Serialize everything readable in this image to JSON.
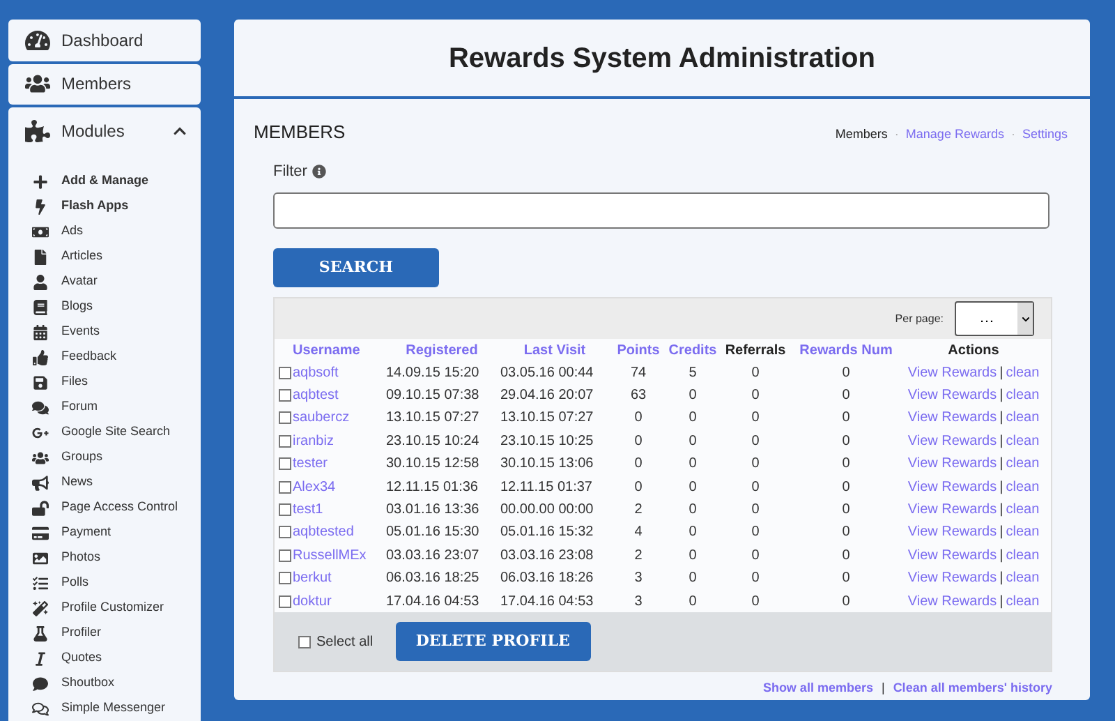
{
  "sidebar": {
    "items": [
      {
        "label": "Dashboard"
      },
      {
        "label": "Members"
      }
    ],
    "modules": {
      "label": "Modules",
      "expanded": true,
      "items": [
        {
          "label": "Add & Manage",
          "bold": true
        },
        {
          "label": "Flash Apps",
          "bold": true
        },
        {
          "label": "Ads",
          "bold": false
        },
        {
          "label": "Articles",
          "bold": false
        },
        {
          "label": "Avatar",
          "bold": false
        },
        {
          "label": "Blogs",
          "bold": false
        },
        {
          "label": "Events",
          "bold": false
        },
        {
          "label": "Feedback",
          "bold": false
        },
        {
          "label": "Files",
          "bold": false
        },
        {
          "label": "Forum",
          "bold": false
        },
        {
          "label": "Google Site Search",
          "bold": false
        },
        {
          "label": "Groups",
          "bold": false
        },
        {
          "label": "News",
          "bold": false
        },
        {
          "label": "Page Access Control",
          "bold": false
        },
        {
          "label": "Payment",
          "bold": false
        },
        {
          "label": "Photos",
          "bold": false
        },
        {
          "label": "Polls",
          "bold": false
        },
        {
          "label": "Profile Customizer",
          "bold": false
        },
        {
          "label": "Profiler",
          "bold": false
        },
        {
          "label": "Quotes",
          "bold": false
        },
        {
          "label": "Shoutbox",
          "bold": false
        },
        {
          "label": "Simple Messenger",
          "bold": false
        }
      ]
    }
  },
  "header": {
    "title": "Rewards System Administration"
  },
  "section": {
    "title": "MEMBERS",
    "nav": [
      {
        "label": "Members",
        "selected": true
      },
      {
        "label": "Manage Rewards",
        "selected": false
      },
      {
        "label": "Settings",
        "selected": false
      }
    ],
    "separator": "·"
  },
  "filter": {
    "label": "Filter"
  },
  "search_button": "SEARCH",
  "per_page": {
    "label": "Per page:",
    "value": "…"
  },
  "table": {
    "columns": [
      {
        "label": "Username",
        "sortable": true
      },
      {
        "label": "Registered",
        "sortable": true
      },
      {
        "label": "Last Visit",
        "sortable": true
      },
      {
        "label": "Points",
        "sortable": true
      },
      {
        "label": "Credits",
        "sortable": true
      },
      {
        "label": "Referrals",
        "sortable": false
      },
      {
        "label": "Rewards Num",
        "sortable": true
      },
      {
        "label": "Actions",
        "sortable": false
      }
    ],
    "rows": [
      {
        "checked": false,
        "cells": [
          "aqbsoft",
          "14.09.15 15:20",
          "03.05.16 00:44",
          "74",
          "5",
          "0",
          "0"
        ],
        "actions": [
          "View Rewards",
          "|",
          "clean"
        ]
      },
      {
        "checked": false,
        "cells": [
          "aqbtest",
          "09.10.15 07:38",
          "29.04.16 20:07",
          "63",
          "0",
          "0",
          "0"
        ],
        "actions": [
          "View Rewards",
          "|",
          "clean"
        ]
      },
      {
        "checked": false,
        "cells": [
          "saubercz",
          "13.10.15 07:27",
          "13.10.15 07:27",
          "0",
          "0",
          "0",
          "0"
        ],
        "actions": [
          "View Rewards",
          "|",
          "clean"
        ]
      },
      {
        "checked": false,
        "cells": [
          "iranbiz",
          "23.10.15 10:24",
          "23.10.15 10:25",
          "0",
          "0",
          "0",
          "0"
        ],
        "actions": [
          "View Rewards",
          "|",
          "clean"
        ]
      },
      {
        "checked": false,
        "cells": [
          "tester",
          "30.10.15 12:58",
          "30.10.15 13:06",
          "0",
          "0",
          "0",
          "0"
        ],
        "actions": [
          "View Rewards",
          "|",
          "clean"
        ]
      },
      {
        "checked": false,
        "cells": [
          "Alex34",
          "12.11.15 01:36",
          "12.11.15 01:37",
          "0",
          "0",
          "0",
          "0"
        ],
        "actions": [
          "View Rewards",
          "|",
          "clean"
        ]
      },
      {
        "checked": false,
        "cells": [
          "test1",
          "03.01.16 13:36",
          "00.00.00 00:00",
          "2",
          "0",
          "0",
          "0"
        ],
        "actions": [
          "View Rewards",
          "|",
          "clean"
        ]
      },
      {
        "checked": false,
        "cells": [
          "aqbtested",
          "05.01.16 15:30",
          "05.01.16 15:32",
          "4",
          "0",
          "0",
          "0"
        ],
        "actions": [
          "View Rewards",
          "|",
          "clean"
        ]
      },
      {
        "checked": false,
        "cells": [
          "RussellMEx",
          "03.03.16 23:07",
          "03.03.16 23:08",
          "2",
          "0",
          "0",
          "0"
        ],
        "actions": [
          "View Rewards",
          "|",
          "clean"
        ]
      },
      {
        "checked": false,
        "cells": [
          "berkut",
          "06.03.16 18:25",
          "06.03.16 18:26",
          "3",
          "0",
          "0",
          "0"
        ],
        "actions": [
          "View Rewards",
          "|",
          "clean"
        ]
      },
      {
        "checked": false,
        "cells": [
          "doktur",
          "17.04.16 04:53",
          "17.04.16 04:53",
          "3",
          "0",
          "0",
          "0"
        ],
        "actions": [
          "View Rewards",
          "|",
          "clean"
        ]
      }
    ]
  },
  "select_all": {
    "label": "Select all",
    "checked": false
  },
  "delete_button": "DELETE PROFILE",
  "footer_links": [
    "Show all members",
    "|",
    "Clean all members' history"
  ]
}
